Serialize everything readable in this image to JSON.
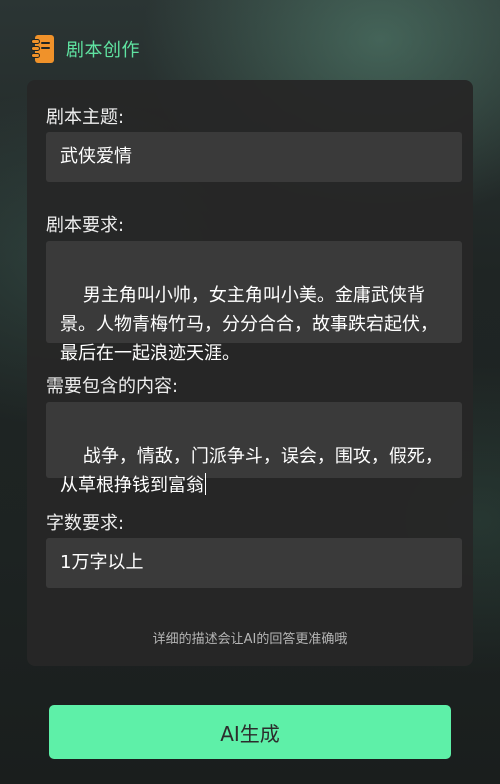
{
  "header": {
    "icon": "notebook-icon",
    "title": "剧本创作"
  },
  "form": {
    "topic": {
      "label": "剧本主题:",
      "value": "武侠爱情"
    },
    "requirements": {
      "label": "剧本要求:",
      "value": "男主角叫小帅，女主角叫小美。金庸武侠背景。人物青梅竹马，分分合合，故事跌宕起伏，最后在一起浪迹天涯。"
    },
    "contents": {
      "label": "需要包含的内容:",
      "value": "战争，情敌，门派争斗，误会，围攻，假死，从草根挣钱到富翁"
    },
    "word_count": {
      "label": "字数要求:",
      "value": "1万字以上"
    },
    "hint": "详细的描述会让AI的回答更准确哦"
  },
  "actions": {
    "generate_label": "AI生成"
  },
  "colors": {
    "accent": "#5ef0a8",
    "icon": "#f0922a"
  }
}
